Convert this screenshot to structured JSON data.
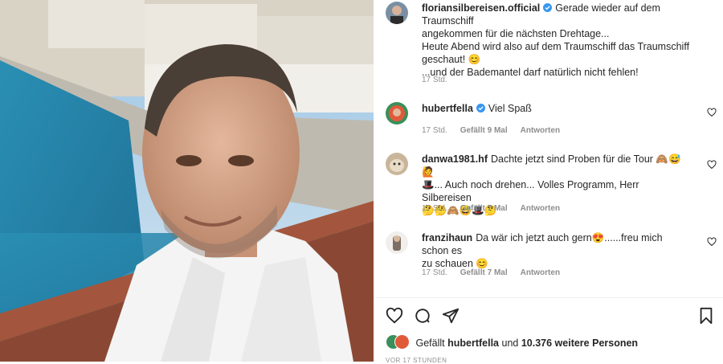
{
  "post": {
    "author": "floriansilbereisen.official",
    "caption_lines": [
      "Gerade wieder auf dem Traumschiff",
      "angekommen für die nächsten Drehtage...",
      "Heute Abend wird also auf dem Traumschiff das Traumschiff",
      "geschaut! 😊",
      "...und der Bademantel darf natürlich nicht fehlen!"
    ],
    "time": "17 Std."
  },
  "comments": [
    {
      "user": "hubertfella",
      "verified": true,
      "text": "Viel Spaß",
      "time": "17 Std.",
      "likes": "Gefällt 9 Mal",
      "reply": "Antworten"
    },
    {
      "user": "danwa1981.hf",
      "verified": false,
      "text_lines": [
        "Dachte jetzt sind Proben für die Tour 🙈😅🙋",
        "🎩... Auch noch drehen... Volles Programm, Herr Silbereisen",
        "🤔🤔🙈😅🎩🤔"
      ],
      "time": "17 Std.",
      "likes": "Gefällt 7 Mal",
      "reply": "Antworten"
    },
    {
      "user": "franzihaun",
      "verified": false,
      "text_lines": [
        "Da wär ich jetzt auch gern😍......freu mich schon es",
        "zu schauen 😊"
      ],
      "time": "17 Std.",
      "likes": "Gefällt 7 Mal",
      "reply": "Antworten"
    }
  ],
  "likes_bar": {
    "prefix": "Gefällt",
    "liker": "hubertfella",
    "middle": "und",
    "rest": "10.376 weitere Personen"
  },
  "date_cut": "VOR 17 STUNDEN",
  "icons": [
    "heart-icon",
    "comment-icon",
    "share-icon",
    "bookmark-icon",
    "verified-icon"
  ],
  "colors": {
    "verified": "#3897f0",
    "meta": "#8e8e8e",
    "text": "#262626"
  }
}
